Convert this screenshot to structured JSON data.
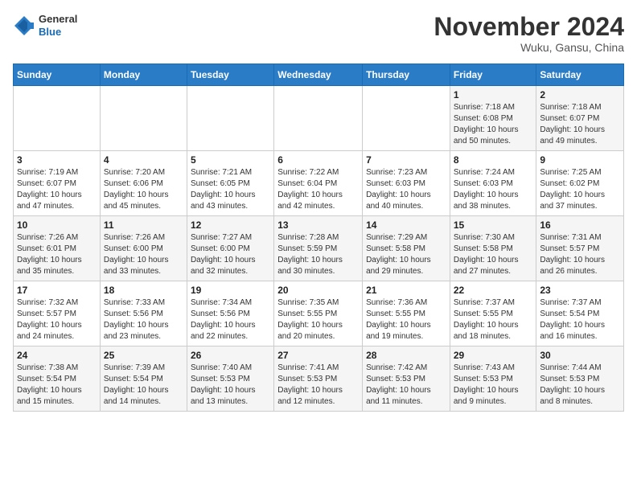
{
  "header": {
    "logo_general": "General",
    "logo_blue": "Blue",
    "month_title": "November 2024",
    "location": "Wuku, Gansu, China"
  },
  "calendar": {
    "days_of_week": [
      "Sunday",
      "Monday",
      "Tuesday",
      "Wednesday",
      "Thursday",
      "Friday",
      "Saturday"
    ],
    "weeks": [
      [
        {
          "day": "",
          "info": ""
        },
        {
          "day": "",
          "info": ""
        },
        {
          "day": "",
          "info": ""
        },
        {
          "day": "",
          "info": ""
        },
        {
          "day": "",
          "info": ""
        },
        {
          "day": "1",
          "info": "Sunrise: 7:18 AM\nSunset: 6:08 PM\nDaylight: 10 hours\nand 50 minutes."
        },
        {
          "day": "2",
          "info": "Sunrise: 7:18 AM\nSunset: 6:07 PM\nDaylight: 10 hours\nand 49 minutes."
        }
      ],
      [
        {
          "day": "3",
          "info": "Sunrise: 7:19 AM\nSunset: 6:07 PM\nDaylight: 10 hours\nand 47 minutes."
        },
        {
          "day": "4",
          "info": "Sunrise: 7:20 AM\nSunset: 6:06 PM\nDaylight: 10 hours\nand 45 minutes."
        },
        {
          "day": "5",
          "info": "Sunrise: 7:21 AM\nSunset: 6:05 PM\nDaylight: 10 hours\nand 43 minutes."
        },
        {
          "day": "6",
          "info": "Sunrise: 7:22 AM\nSunset: 6:04 PM\nDaylight: 10 hours\nand 42 minutes."
        },
        {
          "day": "7",
          "info": "Sunrise: 7:23 AM\nSunset: 6:03 PM\nDaylight: 10 hours\nand 40 minutes."
        },
        {
          "day": "8",
          "info": "Sunrise: 7:24 AM\nSunset: 6:03 PM\nDaylight: 10 hours\nand 38 minutes."
        },
        {
          "day": "9",
          "info": "Sunrise: 7:25 AM\nSunset: 6:02 PM\nDaylight: 10 hours\nand 37 minutes."
        }
      ],
      [
        {
          "day": "10",
          "info": "Sunrise: 7:26 AM\nSunset: 6:01 PM\nDaylight: 10 hours\nand 35 minutes."
        },
        {
          "day": "11",
          "info": "Sunrise: 7:26 AM\nSunset: 6:00 PM\nDaylight: 10 hours\nand 33 minutes."
        },
        {
          "day": "12",
          "info": "Sunrise: 7:27 AM\nSunset: 6:00 PM\nDaylight: 10 hours\nand 32 minutes."
        },
        {
          "day": "13",
          "info": "Sunrise: 7:28 AM\nSunset: 5:59 PM\nDaylight: 10 hours\nand 30 minutes."
        },
        {
          "day": "14",
          "info": "Sunrise: 7:29 AM\nSunset: 5:58 PM\nDaylight: 10 hours\nand 29 minutes."
        },
        {
          "day": "15",
          "info": "Sunrise: 7:30 AM\nSunset: 5:58 PM\nDaylight: 10 hours\nand 27 minutes."
        },
        {
          "day": "16",
          "info": "Sunrise: 7:31 AM\nSunset: 5:57 PM\nDaylight: 10 hours\nand 26 minutes."
        }
      ],
      [
        {
          "day": "17",
          "info": "Sunrise: 7:32 AM\nSunset: 5:57 PM\nDaylight: 10 hours\nand 24 minutes."
        },
        {
          "day": "18",
          "info": "Sunrise: 7:33 AM\nSunset: 5:56 PM\nDaylight: 10 hours\nand 23 minutes."
        },
        {
          "day": "19",
          "info": "Sunrise: 7:34 AM\nSunset: 5:56 PM\nDaylight: 10 hours\nand 22 minutes."
        },
        {
          "day": "20",
          "info": "Sunrise: 7:35 AM\nSunset: 5:55 PM\nDaylight: 10 hours\nand 20 minutes."
        },
        {
          "day": "21",
          "info": "Sunrise: 7:36 AM\nSunset: 5:55 PM\nDaylight: 10 hours\nand 19 minutes."
        },
        {
          "day": "22",
          "info": "Sunrise: 7:37 AM\nSunset: 5:55 PM\nDaylight: 10 hours\nand 18 minutes."
        },
        {
          "day": "23",
          "info": "Sunrise: 7:37 AM\nSunset: 5:54 PM\nDaylight: 10 hours\nand 16 minutes."
        }
      ],
      [
        {
          "day": "24",
          "info": "Sunrise: 7:38 AM\nSunset: 5:54 PM\nDaylight: 10 hours\nand 15 minutes."
        },
        {
          "day": "25",
          "info": "Sunrise: 7:39 AM\nSunset: 5:54 PM\nDaylight: 10 hours\nand 14 minutes."
        },
        {
          "day": "26",
          "info": "Sunrise: 7:40 AM\nSunset: 5:53 PM\nDaylight: 10 hours\nand 13 minutes."
        },
        {
          "day": "27",
          "info": "Sunrise: 7:41 AM\nSunset: 5:53 PM\nDaylight: 10 hours\nand 12 minutes."
        },
        {
          "day": "28",
          "info": "Sunrise: 7:42 AM\nSunset: 5:53 PM\nDaylight: 10 hours\nand 11 minutes."
        },
        {
          "day": "29",
          "info": "Sunrise: 7:43 AM\nSunset: 5:53 PM\nDaylight: 10 hours\nand 9 minutes."
        },
        {
          "day": "30",
          "info": "Sunrise: 7:44 AM\nSunset: 5:53 PM\nDaylight: 10 hours\nand 8 minutes."
        }
      ]
    ]
  }
}
